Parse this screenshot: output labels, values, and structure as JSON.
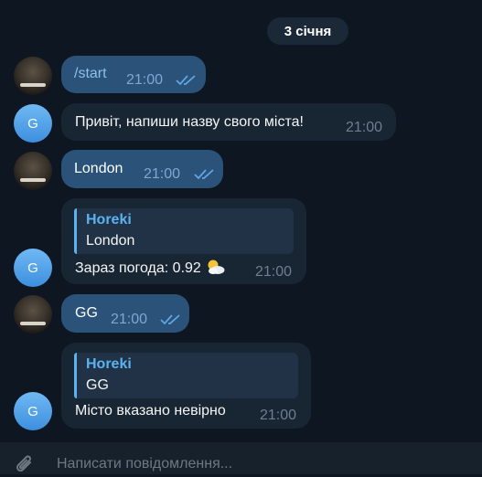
{
  "date_separator": "3 січня",
  "messages": [
    {
      "text": "/start",
      "time": "21:00"
    },
    {
      "text": "Привіт, напиши назву свого міста!",
      "time": "21:00",
      "avatar_letter": "G"
    },
    {
      "text": "London",
      "time": "21:00"
    },
    {
      "reply_name": "Horeki",
      "reply_text": "London",
      "text": "Зараз погода: 0.92",
      "time": "21:00",
      "avatar_letter": "G",
      "emoji": "sun-behind-cloud-icon"
    },
    {
      "text": "GG",
      "time": "21:00"
    },
    {
      "reply_name": "Horeki",
      "reply_text": "GG",
      "text": "Місто вказано невірно",
      "time": "21:00",
      "avatar_letter": "G"
    }
  ],
  "composer": {
    "placeholder": "Написати повідомлення..."
  },
  "colors": {
    "background": "#0e1621",
    "outgoing_bubble": "#2b5278",
    "incoming_bubble": "#182533",
    "accent": "#5ab3f0"
  }
}
